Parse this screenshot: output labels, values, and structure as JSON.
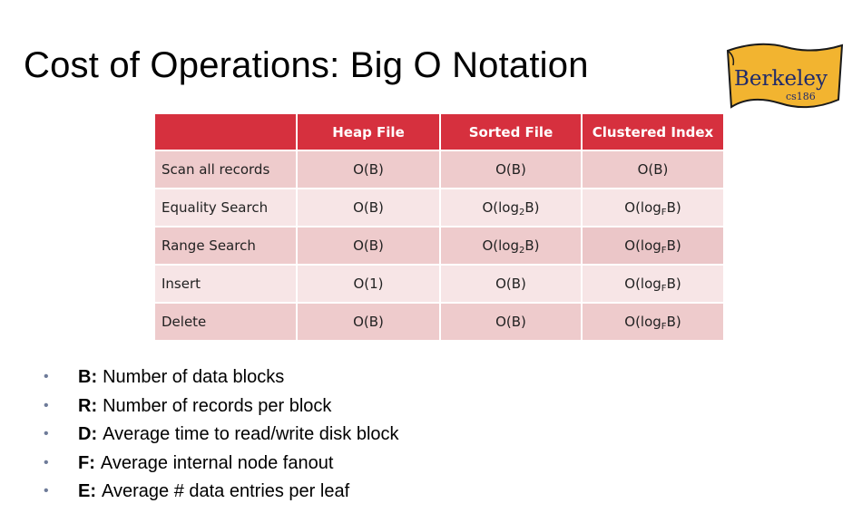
{
  "title": "Cost of Operations: Big O Notation",
  "logo": {
    "text": "Berkeley",
    "sub": "cs186",
    "fill": "#f2b430",
    "stroke": "#1a1a1a"
  },
  "colors": {
    "header": "#d6303e",
    "row_dark": "#eecbcc",
    "row_light": "#f7e5e6"
  },
  "table": {
    "headers": [
      "",
      "Heap File",
      "Sorted File",
      "Clustered Index"
    ],
    "rows": [
      {
        "label": "Scan all records",
        "cells": [
          {
            "t": "O(B)"
          },
          {
            "t": "O(B)"
          },
          {
            "t": "O(B)"
          }
        ]
      },
      {
        "label": "Equality Search",
        "cells": [
          {
            "t": "O(B)"
          },
          {
            "pre": "O(log",
            "sub": "2",
            "post": "B)"
          },
          {
            "pre": "O(log",
            "sub": "F",
            "post": "B)"
          }
        ]
      },
      {
        "label": "Range Search",
        "cells": [
          {
            "t": "O(B)"
          },
          {
            "pre": "O(log",
            "sub": "2",
            "post": "B)"
          },
          {
            "pre": "O(log",
            "sub": "F",
            "post": "B)"
          }
        ]
      },
      {
        "label": "Insert",
        "cells": [
          {
            "t": "O(1)"
          },
          {
            "t": "O(B)"
          },
          {
            "pre": "O(log",
            "sub": "F",
            "post": "B)"
          }
        ]
      },
      {
        "label": "Delete",
        "cells": [
          {
            "t": "O(B)"
          },
          {
            "t": "O(B)"
          },
          {
            "pre": "O(log",
            "sub": "F",
            "post": "B)"
          }
        ]
      }
    ]
  },
  "definitions": [
    {
      "term": "B:",
      "desc": "Number of data blocks"
    },
    {
      "term": "R:",
      "desc": "Number of records per block"
    },
    {
      "term": "D:",
      "desc": "Average time to read/write disk block"
    },
    {
      "term": "F:",
      "desc": "Average internal node fanout"
    },
    {
      "term": "E:",
      "desc": "Average # data entries per leaf"
    }
  ],
  "bullet_glyph": "•"
}
